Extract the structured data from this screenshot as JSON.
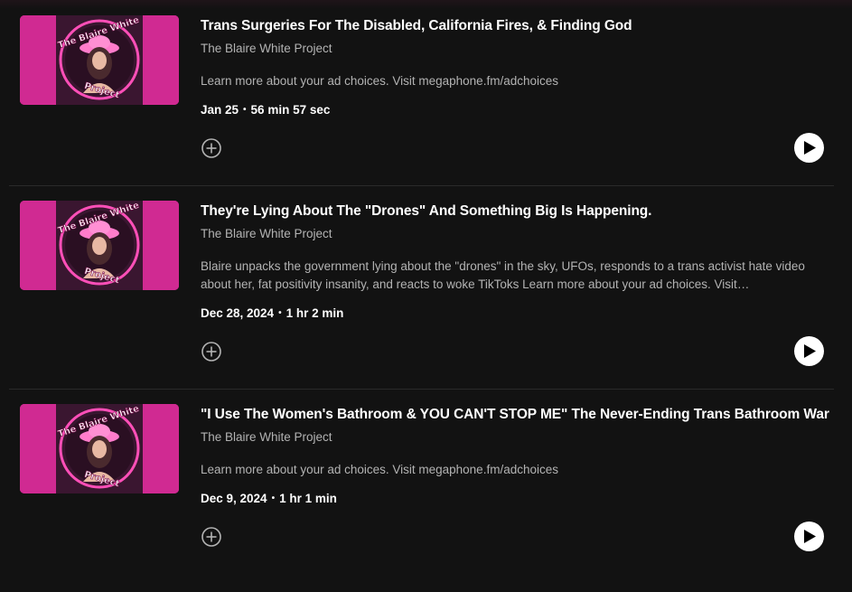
{
  "episodes": [
    {
      "title": "Trans Surgeries For The Disabled, California Fires, & Finding God",
      "show": "The Blaire White Project",
      "description": "Learn more about your ad choices. Visit megaphone.fm/adchoices",
      "date": "Jan 25",
      "duration": "56 min 57 sec",
      "cover_text_top": "The Blaire White",
      "cover_text_bottom": "Project"
    },
    {
      "title": "They're Lying About The \"Drones\" And Something Big Is Happening.",
      "show": "The Blaire White Project",
      "description": "Blaire unpacks the government lying about the \"drones\" in the sky, UFOs, responds to a trans activist hate video about her, fat positivity insanity, and reacts to woke TikToks Learn more about your ad choices. Visit megaphone.fm/adchoices",
      "date": "Dec 28, 2024",
      "duration": "1 hr 2 min",
      "cover_text_top": "The Blaire White",
      "cover_text_bottom": "Project"
    },
    {
      "title": "\"I Use The Women's Bathroom & YOU CAN'T STOP ME\" The Never-Ending Trans Bathroom War",
      "show": "The Blaire White Project",
      "description": "Learn more about your ad choices. Visit megaphone.fm/adchoices",
      "date": "Dec 9, 2024",
      "duration": "1 hr 1 min",
      "cover_text_top": "The Blaire White",
      "cover_text_bottom": "Project"
    }
  ],
  "icons": {
    "add": "plus-circle-icon",
    "play": "play-icon"
  },
  "colors": {
    "background": "#121212",
    "cover_pink": "#c0197a",
    "secondary_text": "#b3b3b3"
  }
}
